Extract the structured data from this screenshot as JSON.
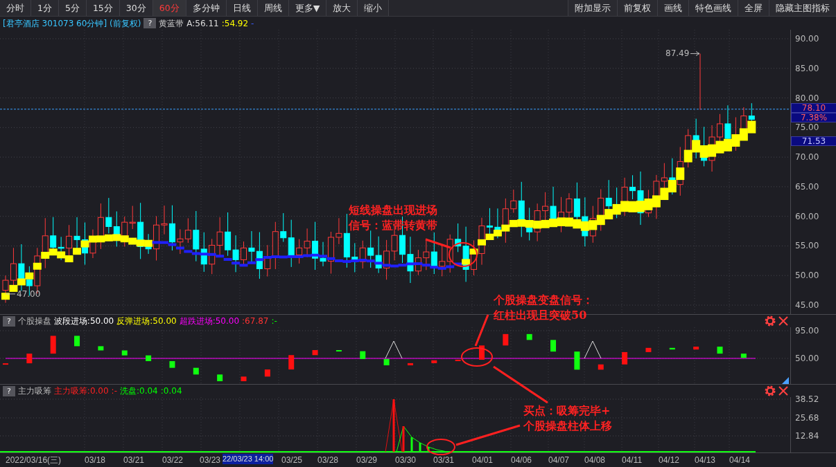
{
  "toolbar": {
    "left": [
      {
        "label": "分时",
        "selected": false
      },
      {
        "label": "1分",
        "selected": false
      },
      {
        "label": "5分",
        "selected": false
      },
      {
        "label": "15分",
        "selected": false
      },
      {
        "label": "30分",
        "selected": false
      },
      {
        "label": "60分",
        "selected": true
      },
      {
        "label": "多分钟",
        "selected": false
      },
      {
        "label": "日线",
        "selected": false
      },
      {
        "label": "周线",
        "selected": false
      },
      {
        "label": "更多▼",
        "selected": false
      },
      {
        "label": "放大",
        "selected": false
      },
      {
        "label": "缩小",
        "selected": false
      }
    ],
    "right": [
      "附加显示",
      "前复权",
      "画线",
      "特色画线",
      "全屏",
      "隐藏主图指标"
    ]
  },
  "main_chart": {
    "title": "[君亭酒店 301073 60分钟]",
    "adjust": "(前复权)",
    "help_button": "?",
    "indicator": "黄蓝带",
    "value_a": "A:56.11",
    "value_b": ":54.92",
    "value_c": "-",
    "y_ticks": [
      "90.00",
      "85.00",
      "80.00",
      "75.00",
      "70.00",
      "65.00",
      "60.00",
      "55.00",
      "50.00",
      "45.00"
    ],
    "high_marker": "87.49",
    "low_marker": "47.00",
    "price_tags": [
      "78.10",
      "7.38%",
      "71.53"
    ]
  },
  "indicator_1": {
    "help_button": "?",
    "name": "个股操盘",
    "legend": [
      {
        "text": "波段进场:50.00",
        "color": "#ffffff"
      },
      {
        "text": "反弹进场:50.00",
        "color": "#ffff00"
      },
      {
        "text": "超跌进场:50.00",
        "color": "#ff00ff"
      },
      {
        "text": ":67.87",
        "color": "#ff3333"
      },
      {
        "text": ":-",
        "color": "#00ff00"
      }
    ],
    "y_ticks": [
      "95.00",
      "50.00"
    ]
  },
  "indicator_2": {
    "help_button": "?",
    "name": "主力吸筹",
    "legend": [
      {
        "text": "主力吸筹:0.00",
        "color": "#ff2020"
      },
      {
        "text": ":-",
        "color": "#ff2020"
      },
      {
        "text": "洗盘:0.04",
        "color": "#00ff00"
      },
      {
        "text": ":0.04",
        "color": "#00ff00"
      }
    ],
    "y_ticks": [
      "38.52",
      "25.68",
      "12.84"
    ]
  },
  "x_axis": {
    "labels": [
      "2022/03/16(三)",
      "03/18",
      "03/21",
      "03/22",
      "03/23",
      "03/25",
      "03/28",
      "03/29",
      "03/30",
      "03/31",
      "04/01",
      "04/06",
      "04/07",
      "04/08",
      "04/11",
      "04/12",
      "04/13",
      "04/14"
    ],
    "cursor_label": "22/03/23 14:00"
  },
  "annotations": [
    {
      "lines": [
        "短线操盘出现进场",
        "信号：蓝带转黄带"
      ]
    },
    {
      "lines": [
        "个股操盘变盘信号：",
        "红柱出现且突破50"
      ]
    },
    {
      "lines": [
        "买点：吸筹完毕+",
        "个股操盘柱体上移"
      ]
    }
  ]
}
